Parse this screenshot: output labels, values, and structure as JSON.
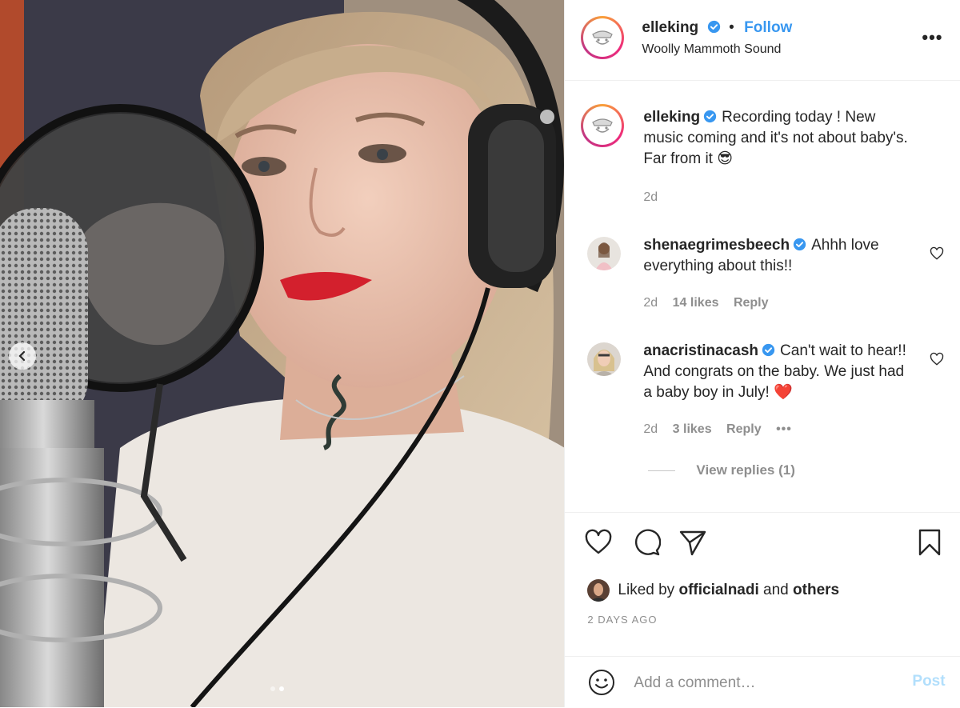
{
  "post": {
    "author": "elleking",
    "follow_label": "Follow",
    "separator": "•",
    "location": "Woolly Mammoth Sound",
    "more_label": "•••"
  },
  "caption": {
    "username": "elleking",
    "text": "Recording today ! New music coming and it's not about baby's. Far from it 😎",
    "time": "2d"
  },
  "comments": [
    {
      "username": "shenaegrimesbeech",
      "text": "Ahhh love everything about this!!",
      "time": "2d",
      "likes": "14 likes",
      "reply_label": "Reply"
    },
    {
      "username": "anacristinacash",
      "text": "Can't wait to hear!! And congrats on the baby. We just had a baby boy in July! ❤️",
      "time": "2d",
      "likes": "3 likes",
      "reply_label": "Reply",
      "more_label": "•••"
    }
  ],
  "view_replies": "View replies (1)",
  "likes": {
    "prefix": "Liked by",
    "user": "officialnadi",
    "connector": "and",
    "others": "others"
  },
  "date": "2 DAYS AGO",
  "comment_box": {
    "placeholder": "Add a comment…",
    "post_label": "Post"
  },
  "carousel": {
    "current_slide": 2,
    "total_slides": 2
  },
  "colors": {
    "link": "#3897f0",
    "text": "#262626",
    "muted": "#8e8e8e",
    "post_disabled": "#b2dffc",
    "heart_emoji": "#ed4956"
  }
}
